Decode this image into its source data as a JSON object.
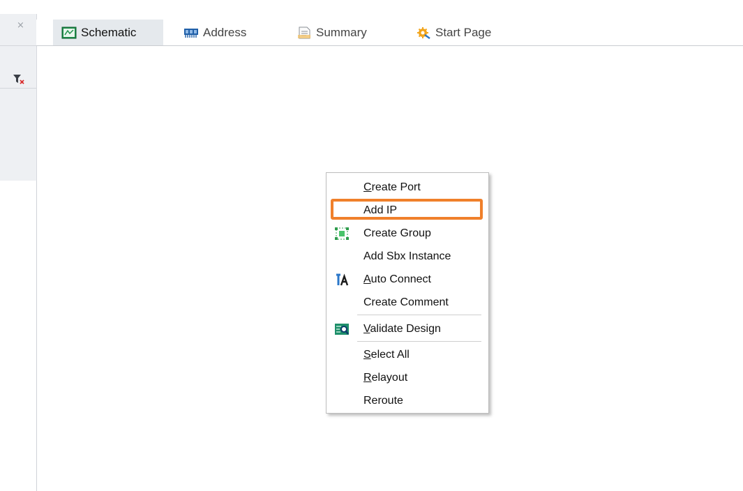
{
  "left_panel": {
    "close_glyph": "×",
    "icons": [
      "close-icon",
      "clear-filter-icon"
    ]
  },
  "tabs": [
    {
      "label": "Schematic",
      "icon": "schematic-icon",
      "active": true
    },
    {
      "label": "Address",
      "icon": "memory-chip-icon",
      "active": false
    },
    {
      "label": "Summary",
      "icon": "document-icon",
      "active": false
    },
    {
      "label": "Start Page",
      "icon": "gear-wrench-icon",
      "active": false
    }
  ],
  "context_menu": {
    "items": [
      {
        "mnemonic": "C",
        "rest": "reate Port"
      },
      {
        "plain": "Add IP",
        "highlighted": true
      },
      {
        "plain": "Create Group",
        "icon": "group-icon"
      },
      {
        "plain": "Add Sbx Instance"
      },
      {
        "mnemonic": "A",
        "rest": "uto Connect",
        "icon": "auto-connect-icon"
      },
      {
        "plain": "Create Comment"
      },
      {
        "mnemonic": "V",
        "rest": "alidate Design",
        "icon": "validate-design-icon"
      },
      {
        "mnemonic": "S",
        "rest": "elect All"
      },
      {
        "mnemonic": "R",
        "rest": "elayout"
      },
      {
        "plain": "Reroute"
      }
    ]
  },
  "colors": {
    "highlight": "#f0802b",
    "active_tab": "#e5e9ed",
    "panel": "#eef0f3"
  }
}
